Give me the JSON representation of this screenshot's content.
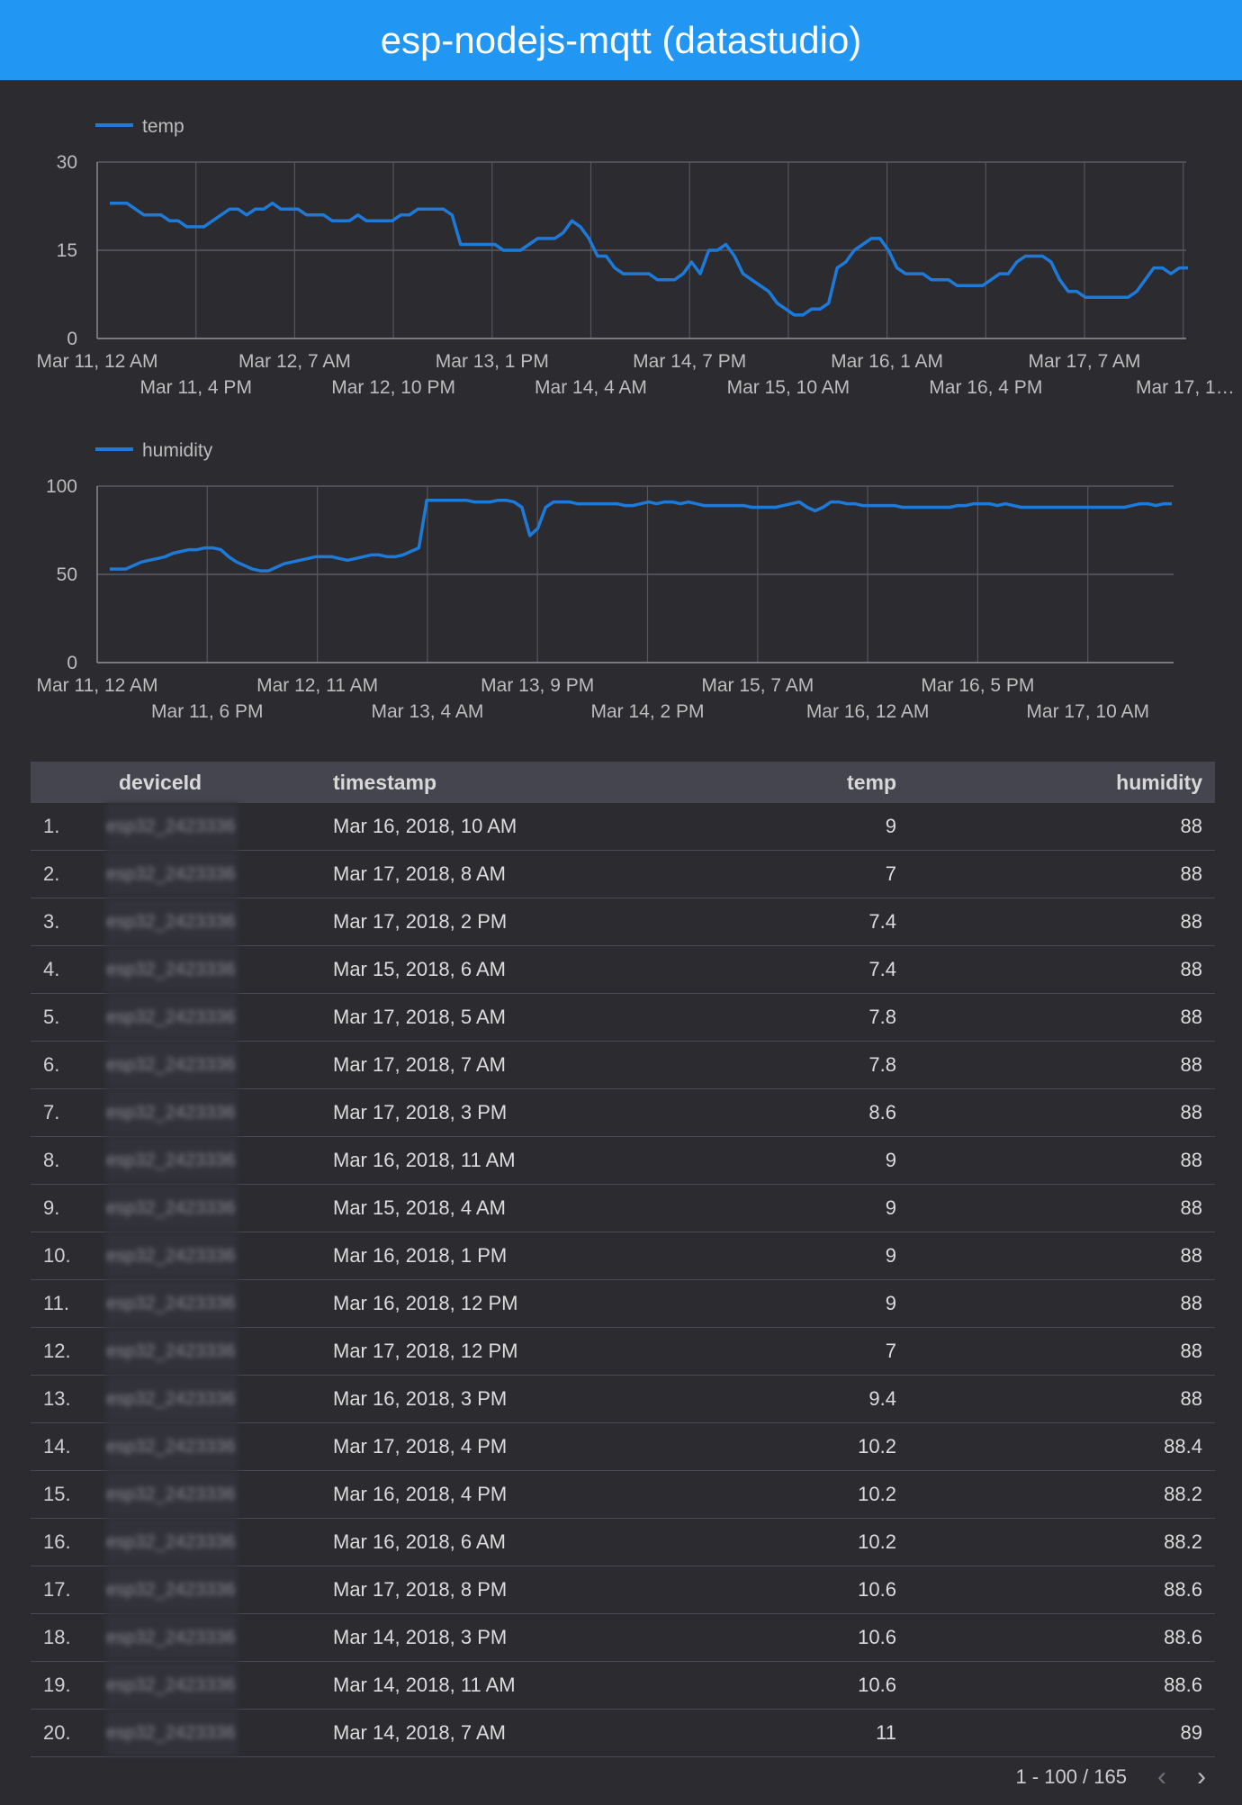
{
  "header": {
    "title": "esp-nodejs-mqtt (datastudio)"
  },
  "colors": {
    "header_bg": "#2196f3",
    "line": "#1e7ad9",
    "background": "#2b2b30"
  },
  "chart_data": [
    {
      "type": "line",
      "series": [
        {
          "name": "temp",
          "values": [
            23,
            23,
            23,
            22,
            21,
            21,
            21,
            20,
            20,
            19,
            19,
            19,
            20,
            21,
            22,
            22,
            21,
            22,
            22,
            23,
            22,
            22,
            22,
            21,
            21,
            21,
            20,
            20,
            20,
            21,
            20,
            20,
            20,
            20,
            21,
            21,
            22,
            22,
            22,
            22,
            21,
            16,
            16,
            16,
            16,
            16,
            15,
            15,
            15,
            16,
            17,
            17,
            17,
            18,
            20,
            19,
            17,
            14,
            14,
            12,
            11,
            11,
            11,
            11,
            10,
            10,
            10,
            11,
            13,
            11,
            15,
            15,
            16,
            14,
            11,
            10,
            9,
            8,
            6,
            5,
            4,
            4,
            5,
            5,
            6,
            12,
            13,
            15,
            16,
            17,
            17,
            15,
            12,
            11,
            11,
            11,
            10,
            10,
            10,
            9,
            9,
            9,
            9,
            10,
            11,
            11,
            13,
            14,
            14,
            14,
            13,
            10,
            8,
            8,
            7,
            7,
            7,
            7,
            7,
            7,
            8,
            10,
            12,
            12,
            11,
            12,
            12
          ]
        }
      ],
      "x_tick_labels": [
        "Mar 11, 12 AM",
        "Mar 11, 4 PM",
        "Mar 12, 7 AM",
        "Mar 12, 10 PM",
        "Mar 13, 1 PM",
        "Mar 14, 4 AM",
        "Mar 14, 7 PM",
        "Mar 15, 10 AM",
        "Mar 16, 1 AM",
        "Mar 16, 4 PM",
        "Mar 17, 7 AM",
        "Mar 17, 1…"
      ],
      "y_ticks": [
        "0",
        "15",
        "30"
      ],
      "ylim": [
        0,
        30
      ],
      "grid": true,
      "legend": "top-left"
    },
    {
      "type": "line",
      "series": [
        {
          "name": "humidity",
          "values": [
            53,
            53,
            53,
            55,
            57,
            58,
            59,
            60,
            62,
            63,
            64,
            64,
            65,
            65,
            64,
            60,
            57,
            55,
            53,
            52,
            52,
            54,
            56,
            57,
            58,
            59,
            60,
            60,
            60,
            59,
            58,
            59,
            60,
            61,
            61,
            60,
            60,
            61,
            63,
            65,
            92,
            92,
            92,
            92,
            92,
            92,
            91,
            91,
            91,
            92,
            92,
            91,
            88,
            72,
            76,
            88,
            91,
            91,
            91,
            90,
            90,
            90,
            90,
            90,
            90,
            89,
            89,
            90,
            91,
            90,
            91,
            91,
            90,
            91,
            90,
            89,
            89,
            89,
            89,
            89,
            89,
            88,
            88,
            88,
            88,
            89,
            90,
            91,
            88,
            86,
            88,
            91,
            91,
            90,
            90,
            89,
            89,
            89,
            89,
            89,
            88,
            88,
            88,
            88,
            88,
            88,
            88,
            89,
            89,
            90,
            90,
            90,
            89,
            90,
            89,
            88,
            88,
            88,
            88,
            88,
            88,
            88,
            88,
            88,
            88,
            88,
            88,
            88,
            88,
            89,
            90,
            90,
            89,
            90,
            90
          ]
        }
      ],
      "x_tick_labels": [
        "Mar 11, 12 AM",
        "Mar 11, 6 PM",
        "Mar 12, 11 AM",
        "Mar 13, 4 AM",
        "Mar 13, 9 PM",
        "Mar 14, 2 PM",
        "Mar 15, 7 AM",
        "Mar 16, 12 AM",
        "Mar 16, 5 PM",
        "Mar 17, 10 AM"
      ],
      "y_ticks": [
        "0",
        "50",
        "100"
      ],
      "ylim": [
        0,
        100
      ],
      "grid": true,
      "legend": "top-left"
    }
  ],
  "table": {
    "columns": [
      "deviceId",
      "timestamp",
      "temp",
      "humidity"
    ],
    "blurred_device_id": "esp32_2423336",
    "rows": [
      [
        "1.",
        "Mar 16, 2018, 10 AM",
        "9",
        "88"
      ],
      [
        "2.",
        "Mar 17, 2018, 8 AM",
        "7",
        "88"
      ],
      [
        "3.",
        "Mar 17, 2018, 2 PM",
        "7.4",
        "88"
      ],
      [
        "4.",
        "Mar 15, 2018, 6 AM",
        "7.4",
        "88"
      ],
      [
        "5.",
        "Mar 17, 2018, 5 AM",
        "7.8",
        "88"
      ],
      [
        "6.",
        "Mar 17, 2018, 7 AM",
        "7.8",
        "88"
      ],
      [
        "7.",
        "Mar 17, 2018, 3 PM",
        "8.6",
        "88"
      ],
      [
        "8.",
        "Mar 16, 2018, 11 AM",
        "9",
        "88"
      ],
      [
        "9.",
        "Mar 15, 2018, 4 AM",
        "9",
        "88"
      ],
      [
        "10.",
        "Mar 16, 2018, 1 PM",
        "9",
        "88"
      ],
      [
        "11.",
        "Mar 16, 2018, 12 PM",
        "9",
        "88"
      ],
      [
        "12.",
        "Mar 17, 2018, 12 PM",
        "7",
        "88"
      ],
      [
        "13.",
        "Mar 16, 2018, 3 PM",
        "9.4",
        "88"
      ],
      [
        "14.",
        "Mar 17, 2018, 4 PM",
        "10.2",
        "88.4"
      ],
      [
        "15.",
        "Mar 16, 2018, 4 PM",
        "10.2",
        "88.2"
      ],
      [
        "16.",
        "Mar 16, 2018, 6 AM",
        "10.2",
        "88.2"
      ],
      [
        "17.",
        "Mar 17, 2018, 8 PM",
        "10.6",
        "88.6"
      ],
      [
        "18.",
        "Mar 14, 2018, 3 PM",
        "10.6",
        "88.6"
      ],
      [
        "19.",
        "Mar 14, 2018, 11 AM",
        "10.6",
        "88.6"
      ],
      [
        "20.",
        "Mar 14, 2018, 7 AM",
        "11",
        "89"
      ]
    ]
  },
  "pager": {
    "range": "1 - 100 / 165",
    "prev_icon": "chevron-left-icon",
    "next_icon": "chevron-right-icon"
  }
}
